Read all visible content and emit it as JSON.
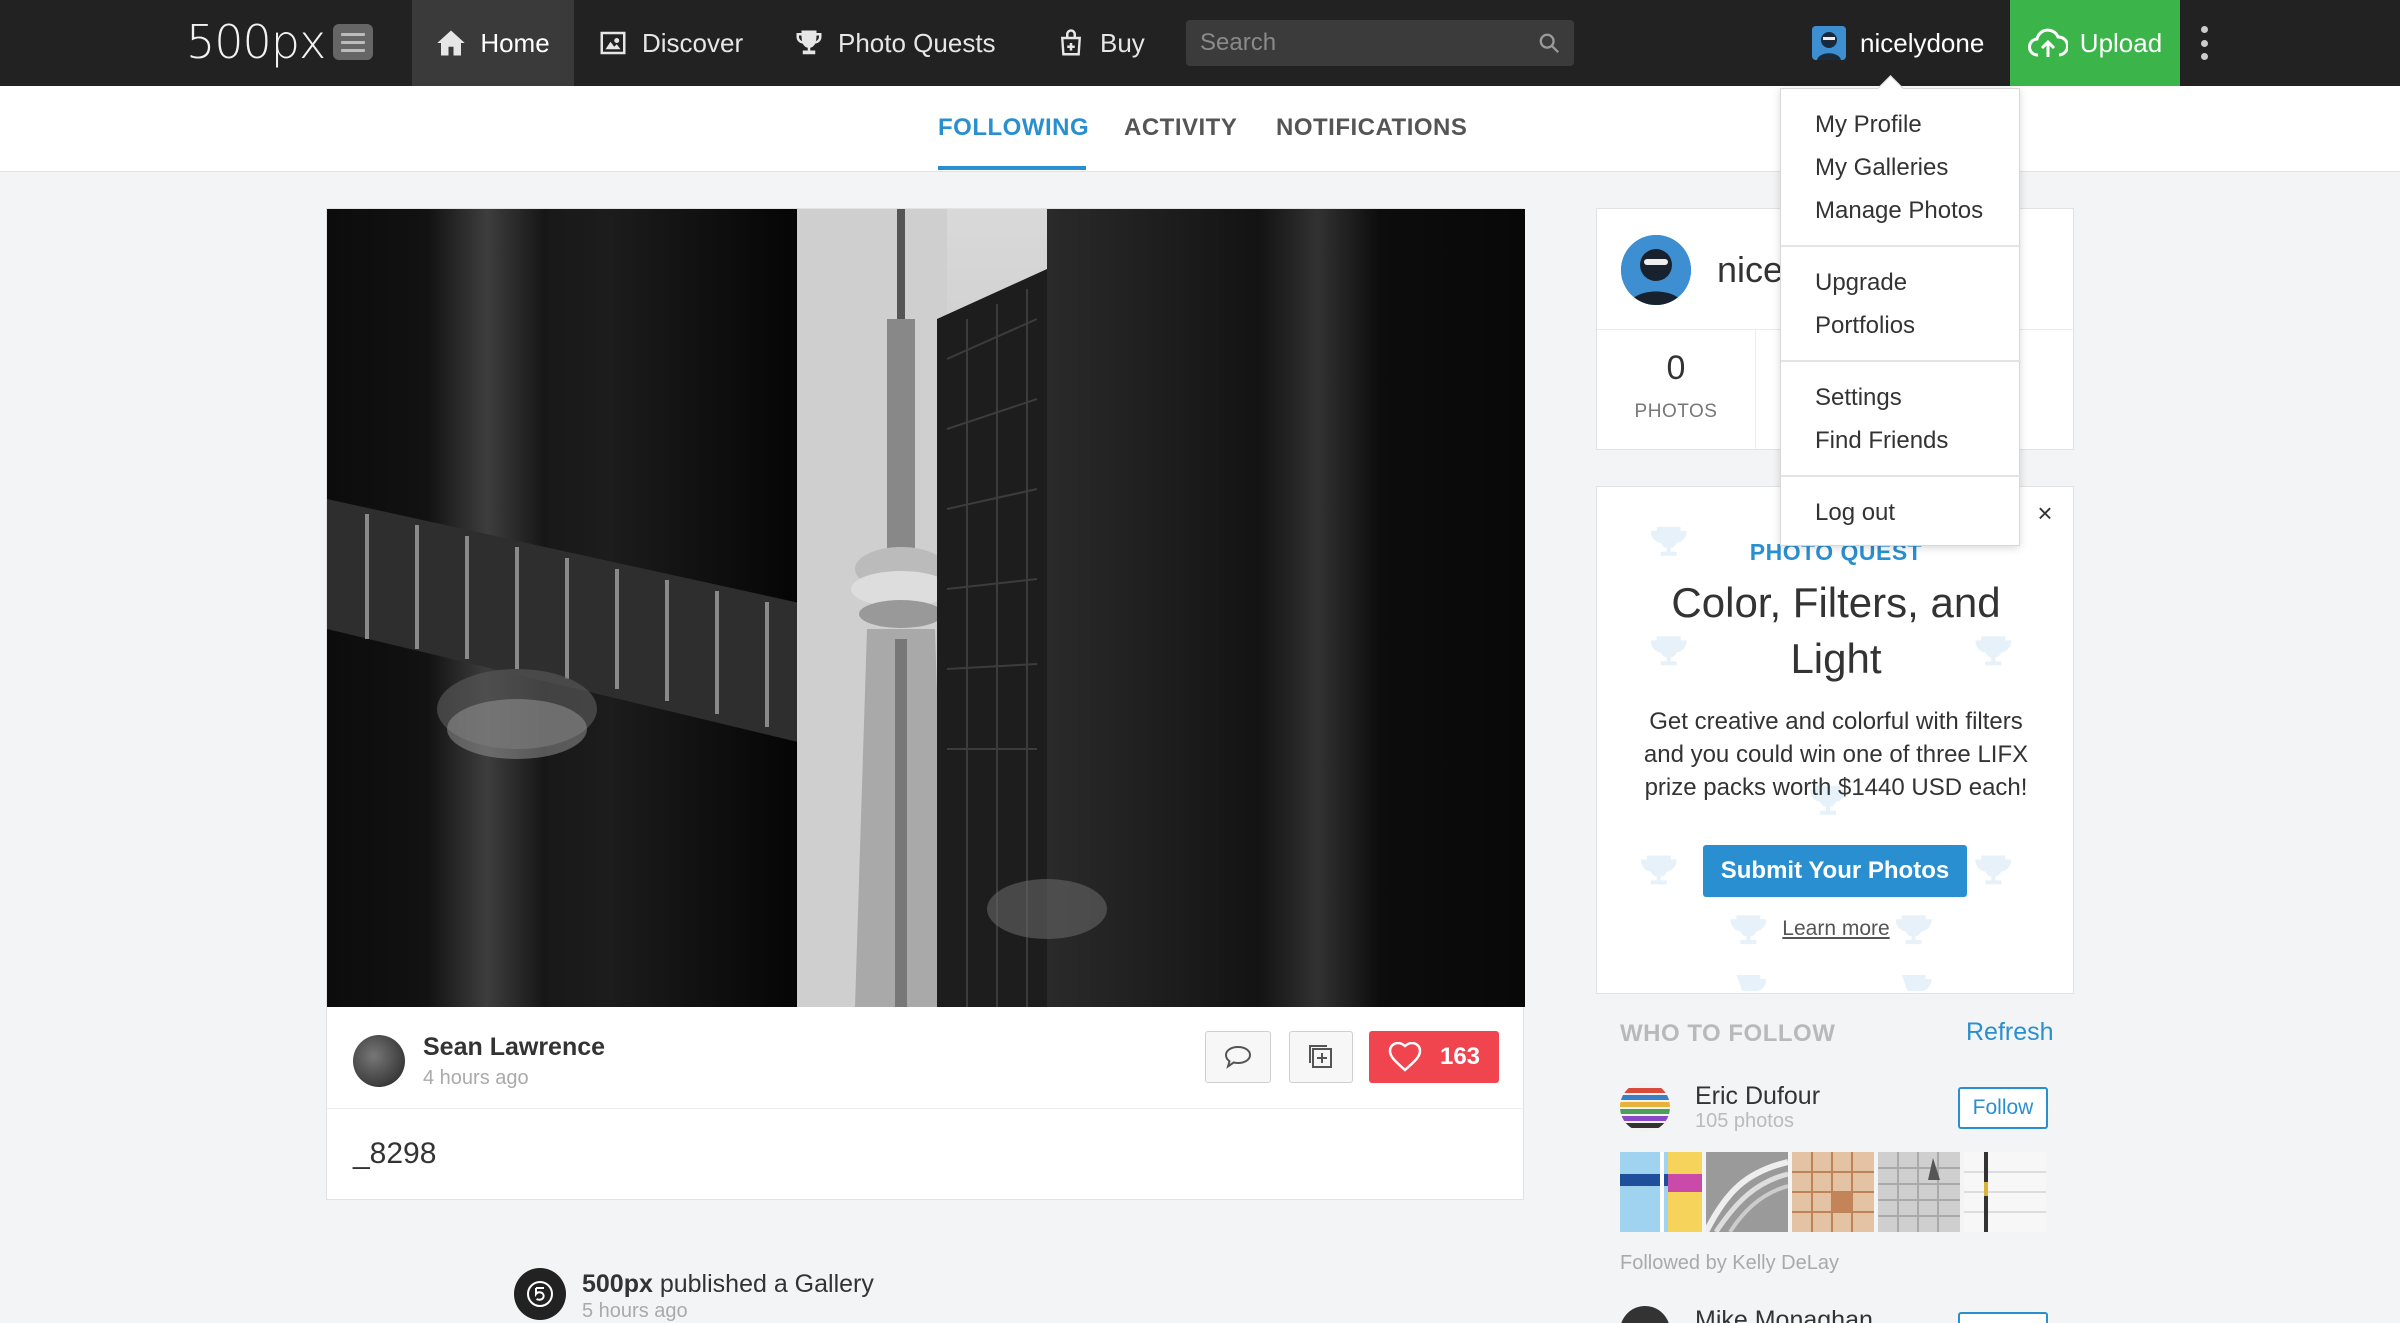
{
  "colors": {
    "topbar": "#222222",
    "accent": "#2a8fd0",
    "upload": "#3bb54a",
    "like": "#f0444f"
  },
  "topbar": {
    "logo_text": "500px",
    "nav": [
      {
        "label": "Home",
        "icon": "home-icon"
      },
      {
        "label": "Discover",
        "icon": "image-icon"
      },
      {
        "label": "Photo Quests",
        "icon": "trophy-icon"
      },
      {
        "label": "Buy",
        "icon": "shopping-bag-icon"
      }
    ],
    "search_placeholder": "Search",
    "username": "nicelydone",
    "upload_label": "Upload"
  },
  "subtabs": [
    "FOLLOWING",
    "ACTIVITY",
    "NOTIFICATIONS"
  ],
  "feed": {
    "author": "Sean Lawrence",
    "time": "4 hours ago",
    "likes": "163",
    "title": "_8298"
  },
  "gallery_notice": {
    "actor": "500px",
    "action": "published a Gallery",
    "time": "5 hours ago"
  },
  "profile": {
    "name_visible": "nice",
    "photos_count": "0",
    "photos_label": "PHOTOS"
  },
  "quest": {
    "kicker": "PHOTO QUEST",
    "title": "Color, Filters, and Light",
    "description": "Get creative and colorful with filters and you could win one of three LIFX prize packs worth $1440 USD each!",
    "submit_label": "Submit Your Photos",
    "learn_more": "Learn more",
    "close_glyph": "×"
  },
  "who_to_follow": {
    "header": "WHO TO FOLLOW",
    "refresh": "Refresh",
    "user": {
      "name": "Eric Dufour",
      "count": "105 photos",
      "follow": "Follow"
    },
    "followed_by": "Followed by Kelly DeLay",
    "next_user": {
      "name": "Mike Monaghan"
    }
  },
  "dropdown": {
    "groups": [
      [
        "My Profile",
        "My Galleries",
        "Manage Photos"
      ],
      [
        "Upgrade",
        "Portfolios"
      ],
      [
        "Settings",
        "Find Friends"
      ],
      [
        "Log out"
      ]
    ]
  }
}
